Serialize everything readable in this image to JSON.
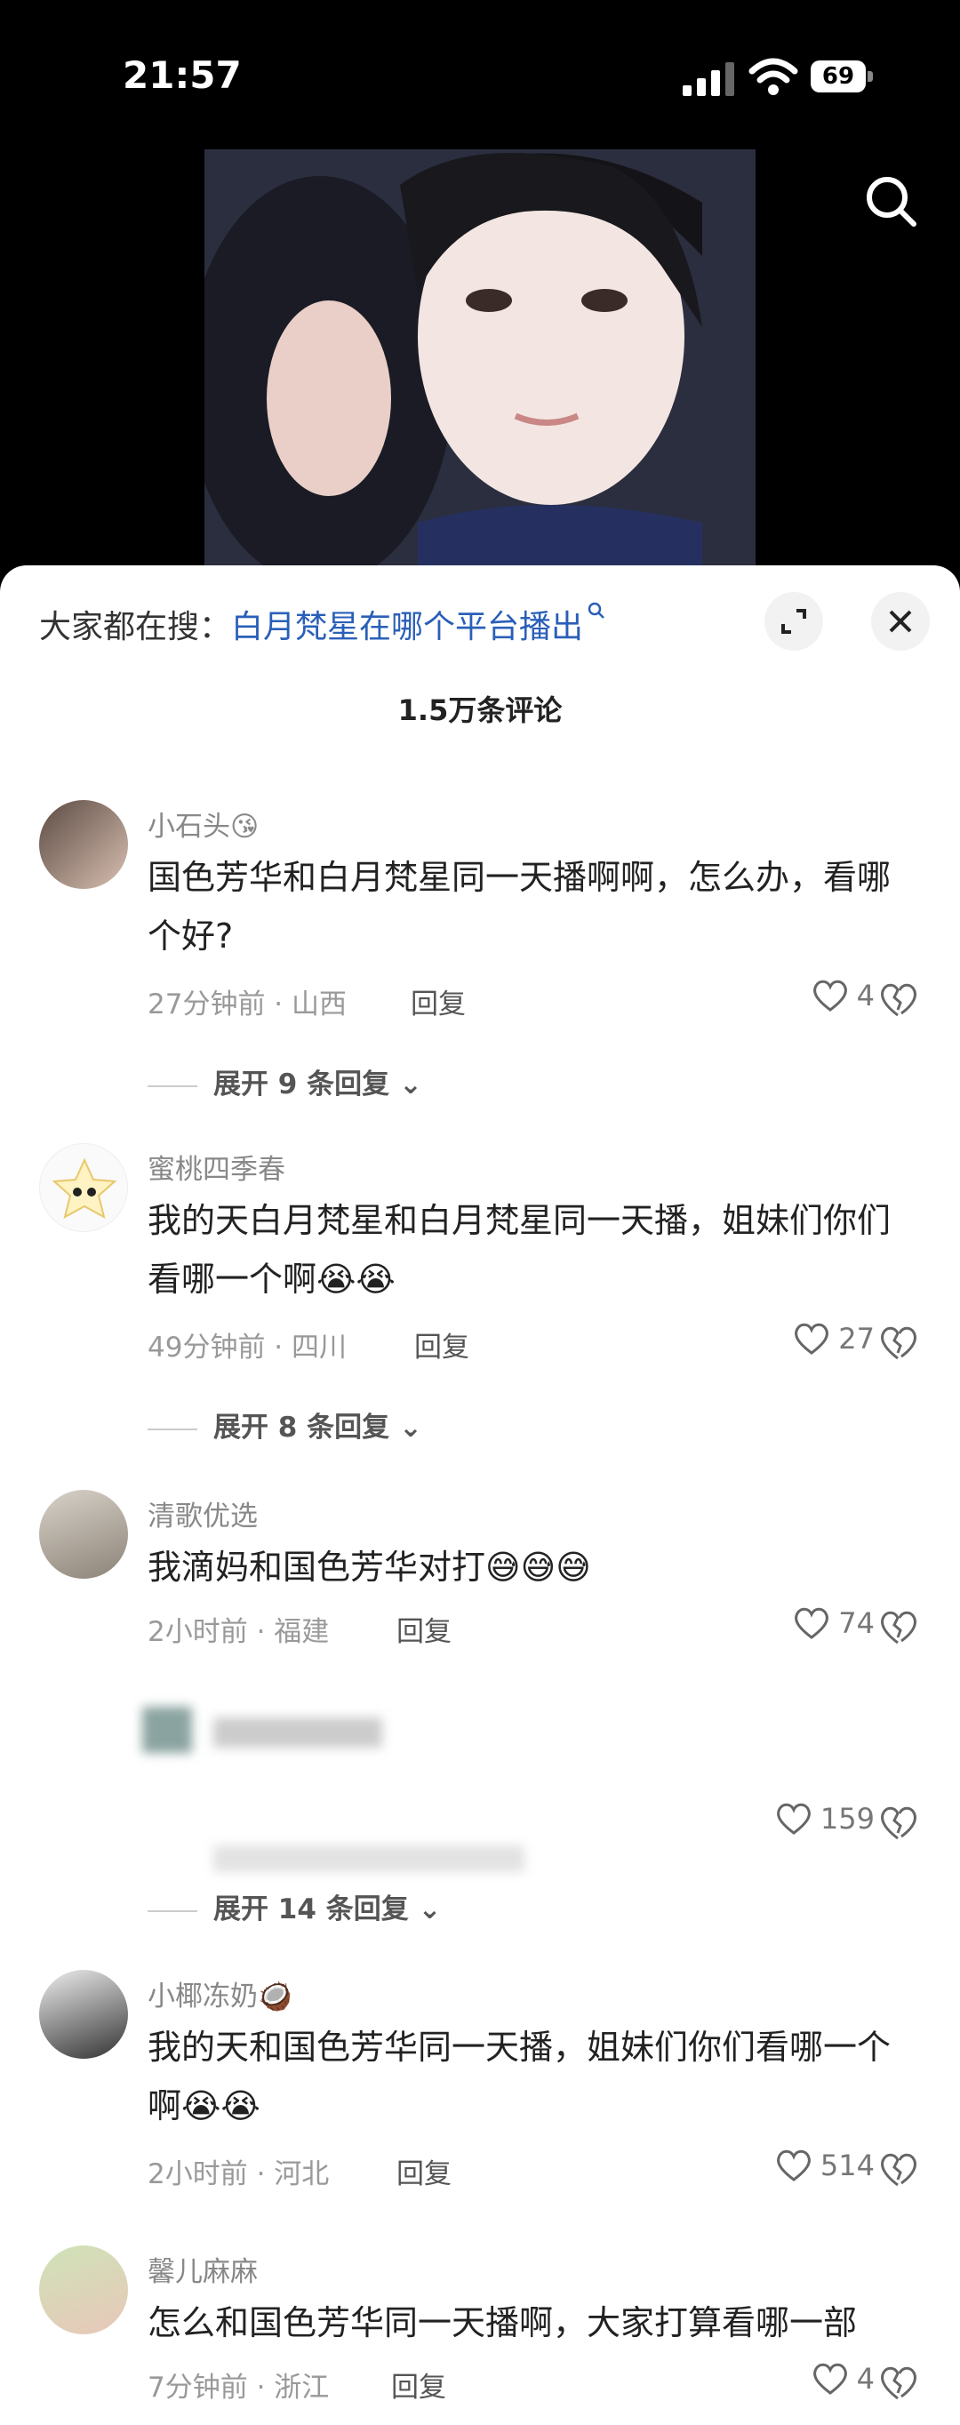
{
  "status": {
    "time": "21:57",
    "battery": "69"
  },
  "search": {
    "prefix": "大家都在搜：",
    "query": "白月梵星在哪个平台播出"
  },
  "comment_count": "1.5万条评论",
  "comments": [
    {
      "name": "小石头",
      "emoji": "😘",
      "text": "国色芳华和白月梵星同一天播啊啊，怎么办，看哪个好?",
      "time": "27分钟前 · 山西",
      "reply": "回复",
      "likes": "4",
      "expand": "展开 9 条回复"
    },
    {
      "name": "蜜桃四季春",
      "emoji": "",
      "text": "我的天白月梵星和白月梵星同一天播，姐妹们你们看哪一个啊😭😭",
      "time": "49分钟前 · 四川",
      "reply": "回复",
      "likes": "27",
      "expand": "展开 8 条回复"
    },
    {
      "name": "清歌优选",
      "emoji": "",
      "text": "我滴妈和国色芳华对打😅😅😅",
      "time": "2小时前 · 福建",
      "reply": "回复",
      "likes": "74",
      "sub_likes": "159",
      "expand": "展开 14 条回复"
    },
    {
      "name": "小椰冻奶",
      "emoji": "🥥",
      "text": "我的天和国色芳华同一天播，姐妹们你们看哪一个啊😭😭",
      "time": "2小时前 · 河北",
      "reply": "回复",
      "likes": "514"
    },
    {
      "name": "馨儿麻麻",
      "emoji": "",
      "text": "怎么和国色芳华同一天播啊，大家打算看哪一部",
      "time": "7分钟前 · 浙江",
      "reply": "回复",
      "likes": "4"
    }
  ]
}
